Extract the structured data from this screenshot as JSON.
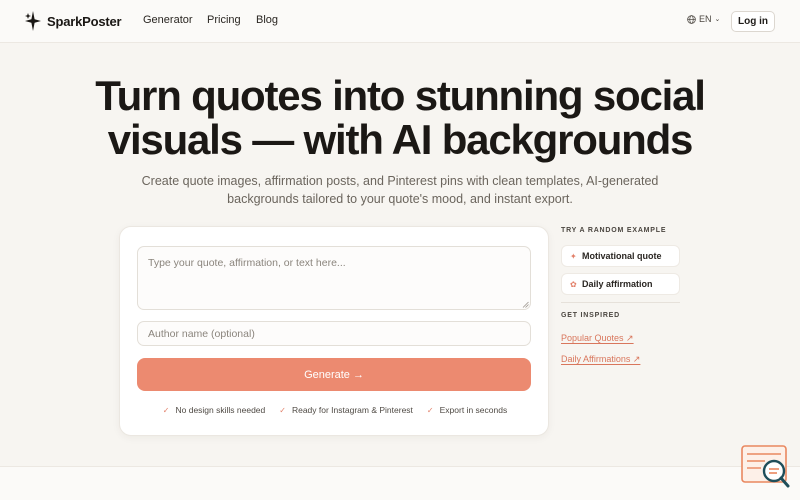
{
  "brand": {
    "name": "SparkPoster"
  },
  "nav": {
    "links": [
      "Generator",
      "Pricing",
      "Blog"
    ],
    "language": "EN",
    "login_label": "Log in"
  },
  "hero": {
    "title": "Turn quotes into stunning social visuals — with AI backgrounds",
    "subtitle": "Create quote images, affirmation posts, and Pinterest pins with clean templates, AI-generated backgrounds tailored to your quote's mood, and instant export."
  },
  "form": {
    "quote_placeholder": "Type your quote, affirmation, or text here...",
    "quote_value": "",
    "author_placeholder": "Author name (optional)",
    "author_value": "",
    "generate_label": "Generate",
    "generate_arrow": "→",
    "features": [
      "No design skills needed",
      "Ready for Instagram & Pinterest",
      "Export in seconds"
    ]
  },
  "sidebar": {
    "random_heading": "TRY A RANDOM EXAMPLE",
    "examples": [
      {
        "label": "Motivational quote",
        "icon": "spark-icon"
      },
      {
        "label": "Daily affirmation",
        "icon": "sun-icon"
      }
    ],
    "inspire_heading": "GET INSPIRED",
    "links": [
      "Popular Quotes ↗",
      "Daily Affirmations ↗"
    ]
  },
  "colors": {
    "accent": "#ec8a70",
    "link": "#d9765c",
    "background": "#f7f5f1"
  }
}
